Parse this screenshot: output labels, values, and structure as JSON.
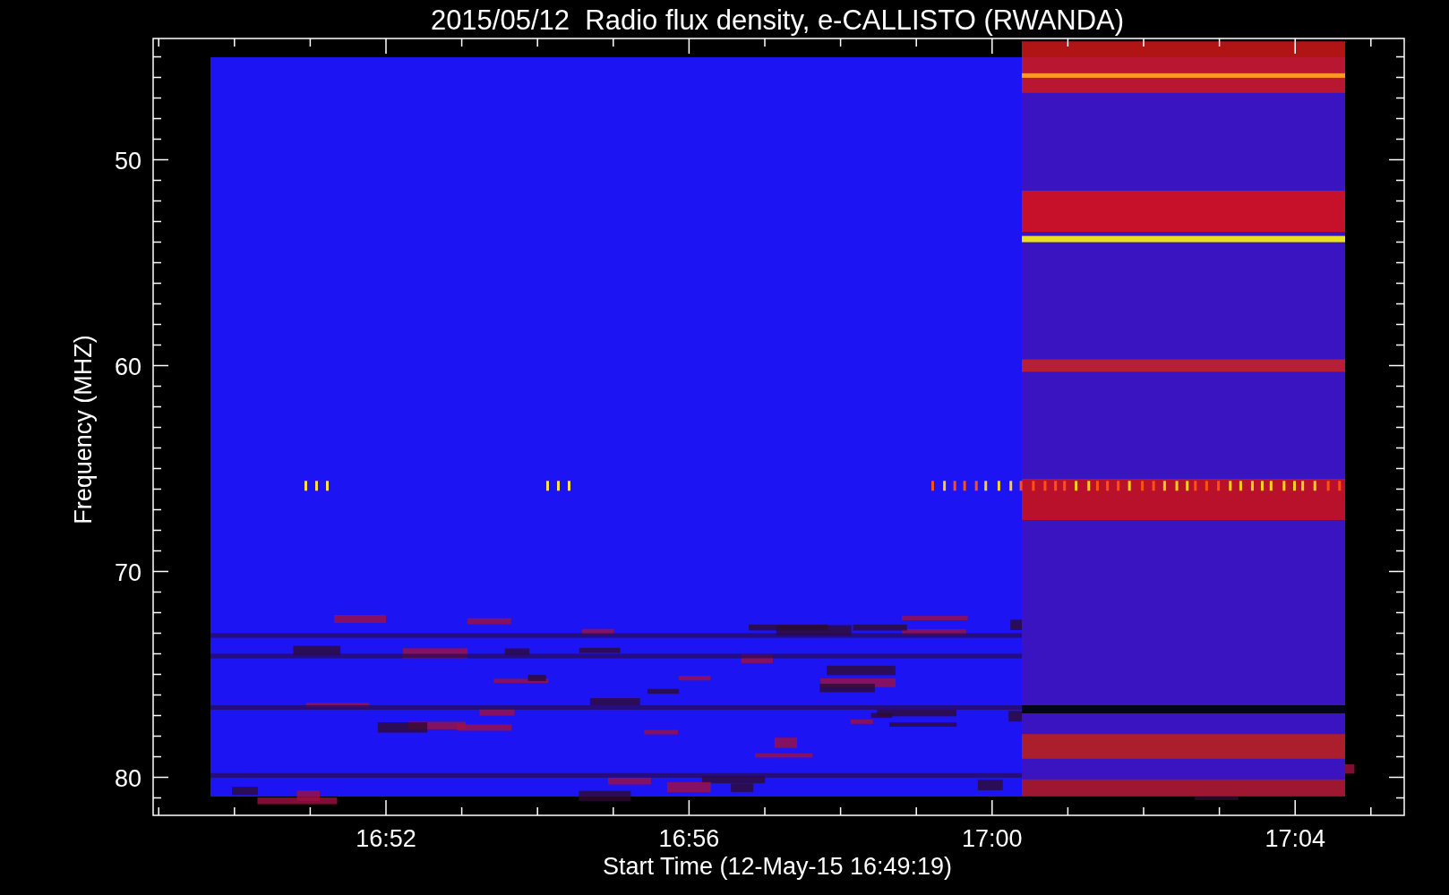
{
  "title": "2015/05/12  Radio flux density, e-CALLISTO (RWANDA)",
  "y_axis": {
    "label": "Frequency (MHZ)",
    "ticks": [
      "50",
      "60",
      "70",
      "80"
    ]
  },
  "x_axis": {
    "label": "Start Time (12-May-15 16:49:19)",
    "ticks": [
      "16:52",
      "16:56",
      "17:00",
      "17:04"
    ]
  }
}
